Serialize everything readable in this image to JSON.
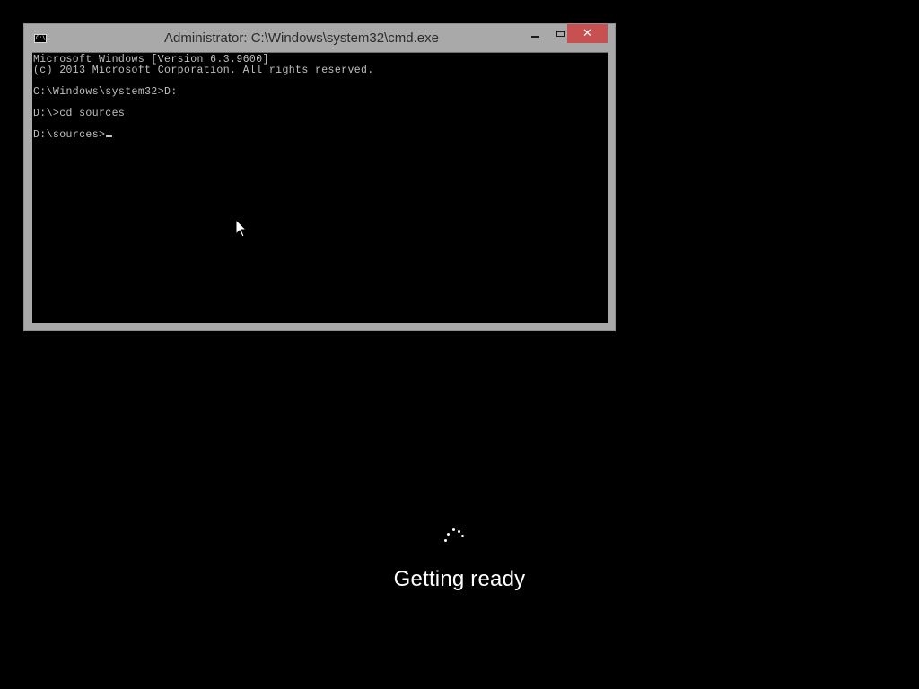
{
  "window": {
    "title": "Administrator: C:\\Windows\\system32\\cmd.exe",
    "app_icon_text": "C:\\.",
    "minimize_label": "Minimize",
    "maximize_label": "Maximize",
    "close_label": "Close"
  },
  "console": {
    "lines": [
      "Microsoft Windows [Version 6.3.9600]",
      "(c) 2013 Microsoft Corporation. All rights reserved.",
      "",
      "C:\\Windows\\system32>D:",
      "",
      "D:\\>cd sources",
      "",
      "D:\\sources>"
    ]
  },
  "setup": {
    "status_text": "Getting ready"
  },
  "colors": {
    "close_button": "#c75050",
    "window_frame": "#a9a9a9",
    "console_text": "#c0c0c0",
    "background": "#000000"
  }
}
